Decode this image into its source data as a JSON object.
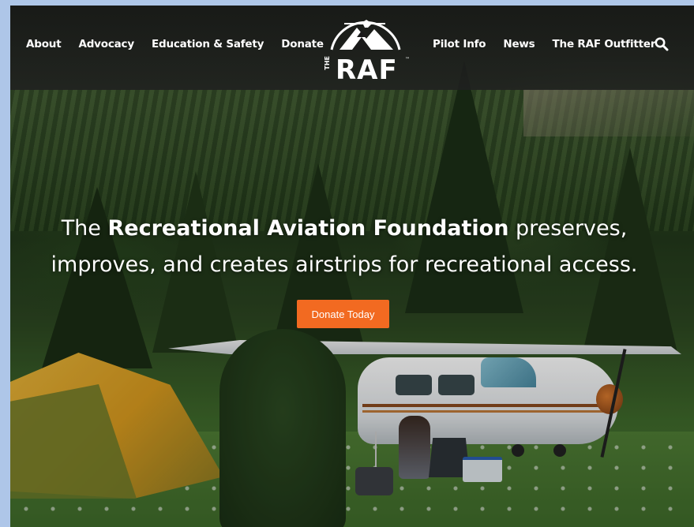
{
  "nav": {
    "left": [
      "About",
      "Advocacy",
      "Education & Safety",
      "Donate"
    ],
    "right": [
      "Pilot Info",
      "News",
      "The RAF Outfitter"
    ]
  },
  "logo": {
    "the": "THE",
    "name": "RAF",
    "tm": "™"
  },
  "hero": {
    "headline_prefix": "The ",
    "headline_bold": "Recreational Aviation Foundation",
    "headline_suffix": " preserves,",
    "headline_line2": "improves, and creates airstrips for recreational access.",
    "cta_label": "Donate Today"
  },
  "colors": {
    "accent": "#f26a21",
    "header_bg": "#1a1a1a",
    "frame": "#aec6e8"
  },
  "icons": {
    "search": "search-icon"
  }
}
